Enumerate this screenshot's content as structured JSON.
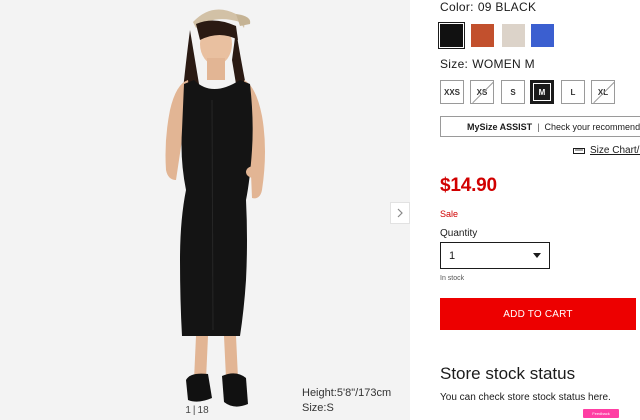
{
  "product_image": {
    "model_height": "Height:5'8\"/173cm",
    "model_size": "Size:S",
    "pager": {
      "current": "1",
      "separator": "|",
      "total": "18"
    }
  },
  "color": {
    "label": "Color:",
    "selected": "09 BLACK",
    "swatches": [
      {
        "name": "black",
        "hex": "#111111",
        "selected": true
      },
      {
        "name": "orange",
        "hex": "#c2502d",
        "selected": false
      },
      {
        "name": "natural",
        "hex": "#dcd3c9",
        "selected": false
      },
      {
        "name": "blue",
        "hex": "#3b5fd0",
        "selected": false
      }
    ]
  },
  "size": {
    "label": "Size:",
    "selected": "WOMEN M",
    "options": [
      {
        "label": "XXS",
        "available": true,
        "selected": false
      },
      {
        "label": "XS",
        "available": false,
        "selected": false
      },
      {
        "label": "S",
        "available": true,
        "selected": false
      },
      {
        "label": "M",
        "available": true,
        "selected": true
      },
      {
        "label": "L",
        "available": true,
        "selected": false
      },
      {
        "label": "XL",
        "available": false,
        "selected": false
      }
    ]
  },
  "mysize": {
    "brand": "MySize ASSIST",
    "separator": "|",
    "text": "Check your recommended s"
  },
  "size_chart": {
    "label": "Size Chart/("
  },
  "price": "$14.90",
  "sale_label": "Sale",
  "quantity": {
    "label": "Quantity",
    "value": "1"
  },
  "stock_status": "In stock",
  "add_to_cart": "ADD TO CART",
  "store": {
    "title": "Store stock status",
    "text": "You can check store stock status here."
  },
  "feedback_badge": "Feedback"
}
